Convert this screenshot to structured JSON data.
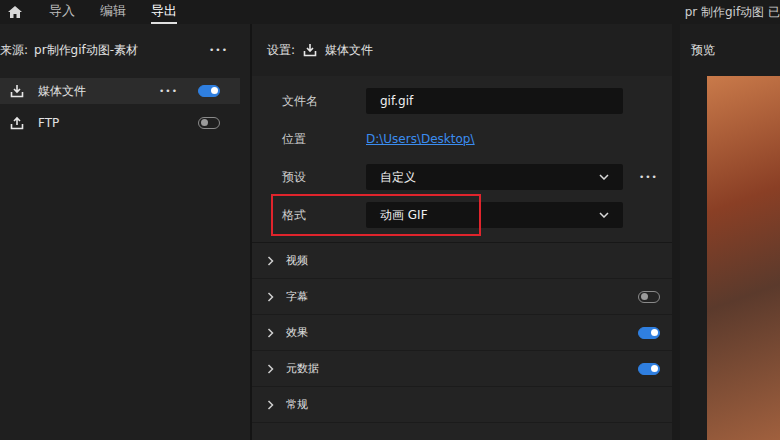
{
  "topbar": {
    "nav": [
      {
        "label": "导入",
        "selected": false
      },
      {
        "label": "编辑",
        "selected": false
      },
      {
        "label": "导出",
        "selected": true
      }
    ],
    "title": "pr 制作gif动图 已"
  },
  "source": {
    "label": "来源:",
    "name": "pr制作gif动图-素材",
    "menu": "•••"
  },
  "destinations": [
    {
      "label": "媒体文件",
      "selected": true,
      "on": true,
      "menu": "•••"
    },
    {
      "label": "FTP",
      "selected": false,
      "on": false,
      "menu": ""
    }
  ],
  "settings": {
    "label": "设置:",
    "target": "媒体文件",
    "fields": [
      {
        "kind": "input",
        "label": "文件名",
        "value": "gif.gif",
        "menu": "",
        "highlighted": false
      },
      {
        "kind": "link",
        "label": "位置",
        "value": "D:\\Users\\Desktop\\",
        "menu": "",
        "highlighted": false
      },
      {
        "kind": "select",
        "label": "预设",
        "value": "自定义",
        "menu": "•••",
        "highlighted": false
      },
      {
        "kind": "select",
        "label": "格式",
        "value": "动画 GIF",
        "menu": "",
        "highlighted": true
      }
    ],
    "sections": [
      {
        "label": "视频",
        "kind": "plain",
        "on": false
      },
      {
        "label": "字幕",
        "kind": "toggle",
        "on": false
      },
      {
        "label": "效果",
        "kind": "toggle",
        "on": true
      },
      {
        "label": "元数据",
        "kind": "toggle",
        "on": true
      },
      {
        "label": "常规",
        "kind": "plain",
        "on": false
      }
    ]
  },
  "preview": {
    "label": "预览"
  }
}
